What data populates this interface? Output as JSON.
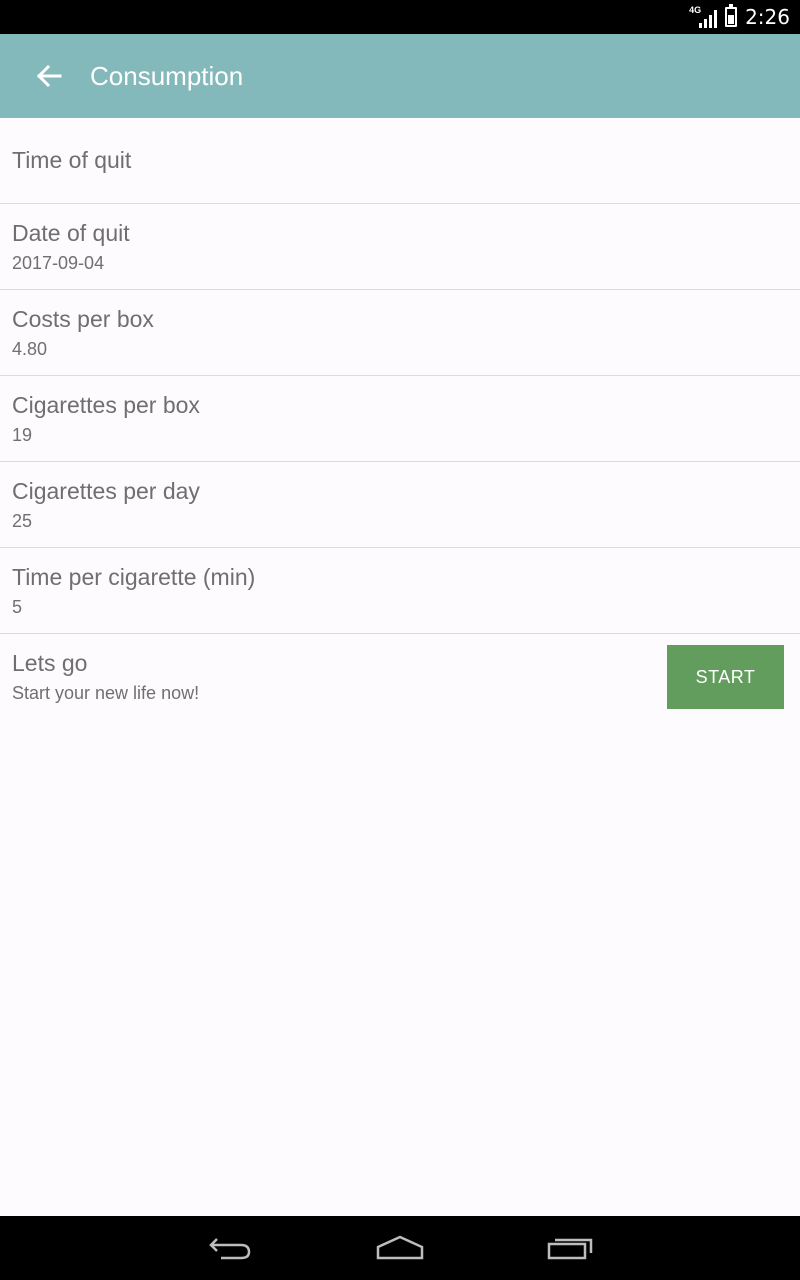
{
  "status_bar": {
    "network_label": "4G",
    "time": "2:26"
  },
  "app_bar": {
    "title": "Consumption",
    "back_icon": "arrow-left-icon"
  },
  "settings": [
    {
      "title": "Time of quit",
      "value": ""
    },
    {
      "title": "Date of quit",
      "value": "2017-09-04"
    },
    {
      "title": "Costs per box",
      "value": "4.80"
    },
    {
      "title": "Cigarettes per box",
      "value": "19"
    },
    {
      "title": "Cigarettes per day",
      "value": "25"
    },
    {
      "title": "Time per cigarette (min)",
      "value": "5"
    },
    {
      "title": "Lets go",
      "value": "Start your new life now!"
    }
  ],
  "start_button": {
    "label": "START",
    "color": "#629d5e"
  },
  "colors": {
    "app_bar": "#84b9bc",
    "background": "#fdfbfd",
    "status_bar": "#000000"
  },
  "nav_bar": {
    "icons": [
      "back-icon",
      "home-icon",
      "recents-icon"
    ]
  }
}
